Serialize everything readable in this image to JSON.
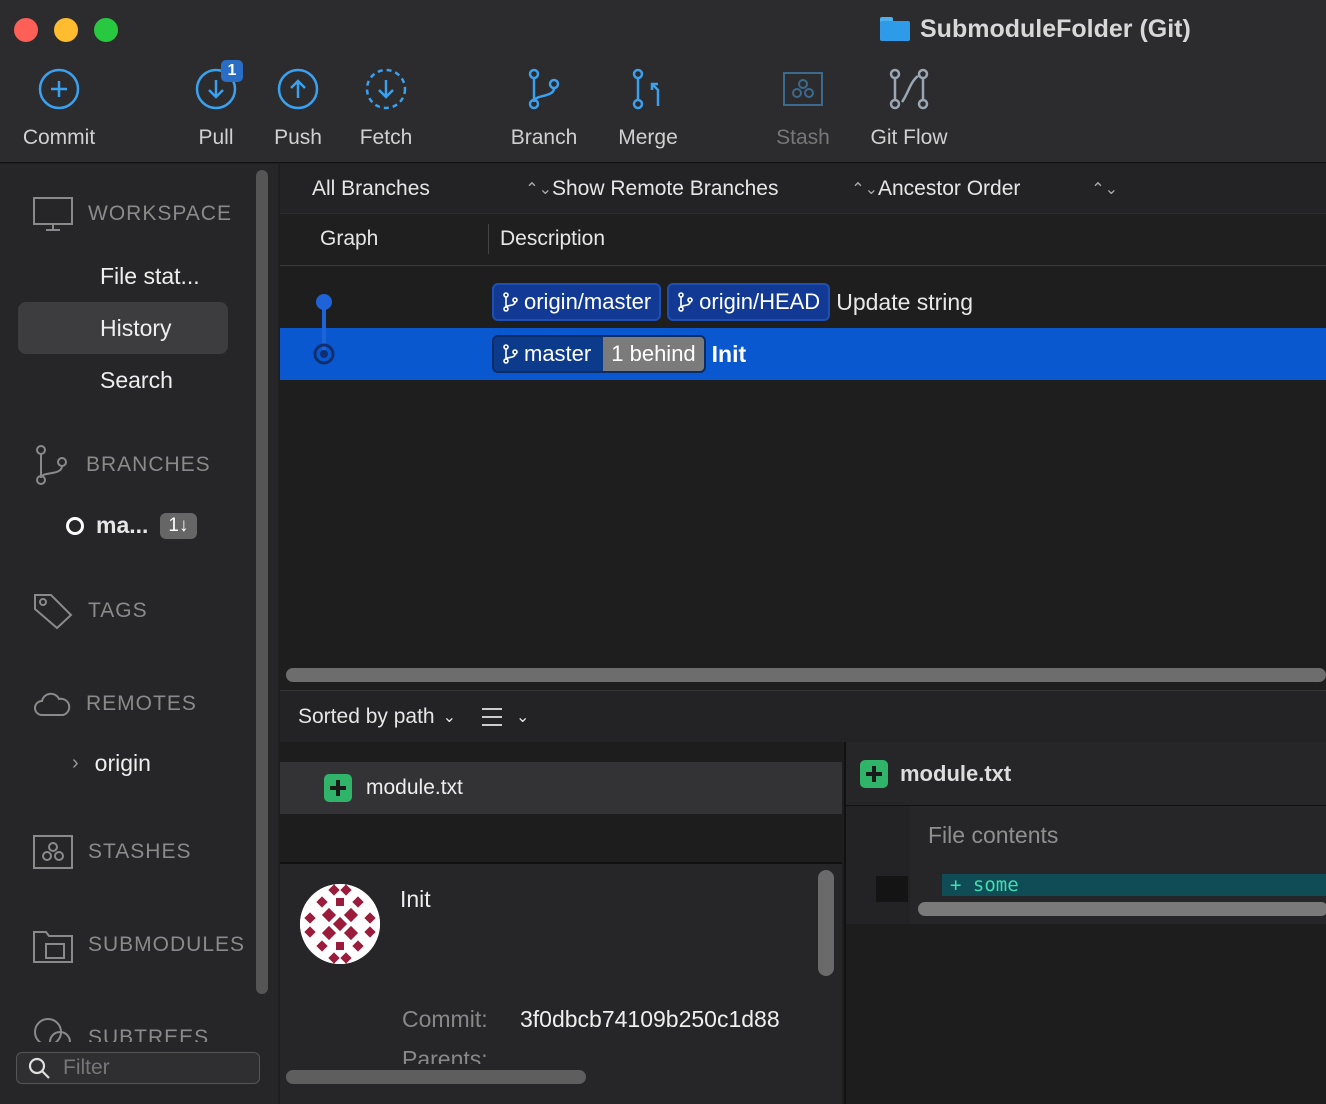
{
  "window": {
    "title": "SubmoduleFolder (Git)"
  },
  "toolbar": {
    "commit": "Commit",
    "pull": "Pull",
    "pull_badge": "1",
    "push": "Push",
    "fetch": "Fetch",
    "branch": "Branch",
    "merge": "Merge",
    "stash": "Stash",
    "gitflow": "Git Flow"
  },
  "sidebar": {
    "workspace": "WORKSPACE",
    "items": [
      "File stat...",
      "History",
      "Search"
    ],
    "active_item": "History",
    "branches": "BRANCHES",
    "branch_name": "ma...",
    "branch_badge": "1↓",
    "tags": "TAGS",
    "remotes": "REMOTES",
    "remote_name": "origin",
    "stashes": "STASHES",
    "submodules": "SUBMODULES",
    "subtrees": "SUBTREES",
    "filter_placeholder": "Filter"
  },
  "filters": {
    "branches": "All Branches",
    "remote": "Show Remote Branches",
    "order": "Ancestor Order"
  },
  "history": {
    "col_graph": "Graph",
    "col_description": "Description",
    "commits": [
      {
        "refs": [
          "origin/master",
          "origin/HEAD"
        ],
        "message": "Update string",
        "selected": false
      },
      {
        "refs": [
          "master"
        ],
        "behind": "1 behind",
        "message": "Init",
        "selected": true
      }
    ]
  },
  "files": {
    "sort": "Sorted by path",
    "list": [
      "module.txt"
    ]
  },
  "commit": {
    "title": "Init",
    "commit_label": "Commit:",
    "commit_hash": "3f0dbcb74109b250c1d88",
    "parents_label": "Parents:"
  },
  "diff": {
    "file": "module.txt",
    "hunk_title": "File contents",
    "added_line": "+ some"
  },
  "colors": {
    "accent": "#0a58cf",
    "ref_bg": "#123a94",
    "added": "#2fb46a"
  }
}
